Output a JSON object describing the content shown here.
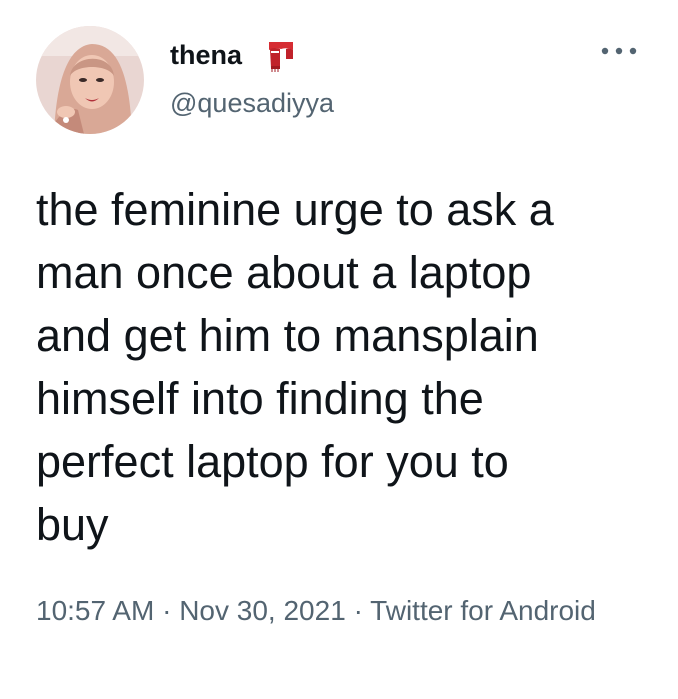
{
  "user": {
    "display_name": "thena",
    "name_emoji": "scarf-emoji",
    "handle": "@quesadiyya"
  },
  "menu": {
    "more_icon": "more-options-icon"
  },
  "tweet": {
    "text": "the feminine urge to ask a\nman once about a laptop\nand get him to mansplain\nhimself into finding the\nperfect laptop for you to\nbuy",
    "time": "10:57 AM",
    "separator": "·",
    "date": "Nov 30, 2021",
    "source": "Twitter for Android"
  },
  "colors": {
    "text": "#0f1419",
    "secondary": "#536471",
    "scarf": "#d62c33"
  }
}
